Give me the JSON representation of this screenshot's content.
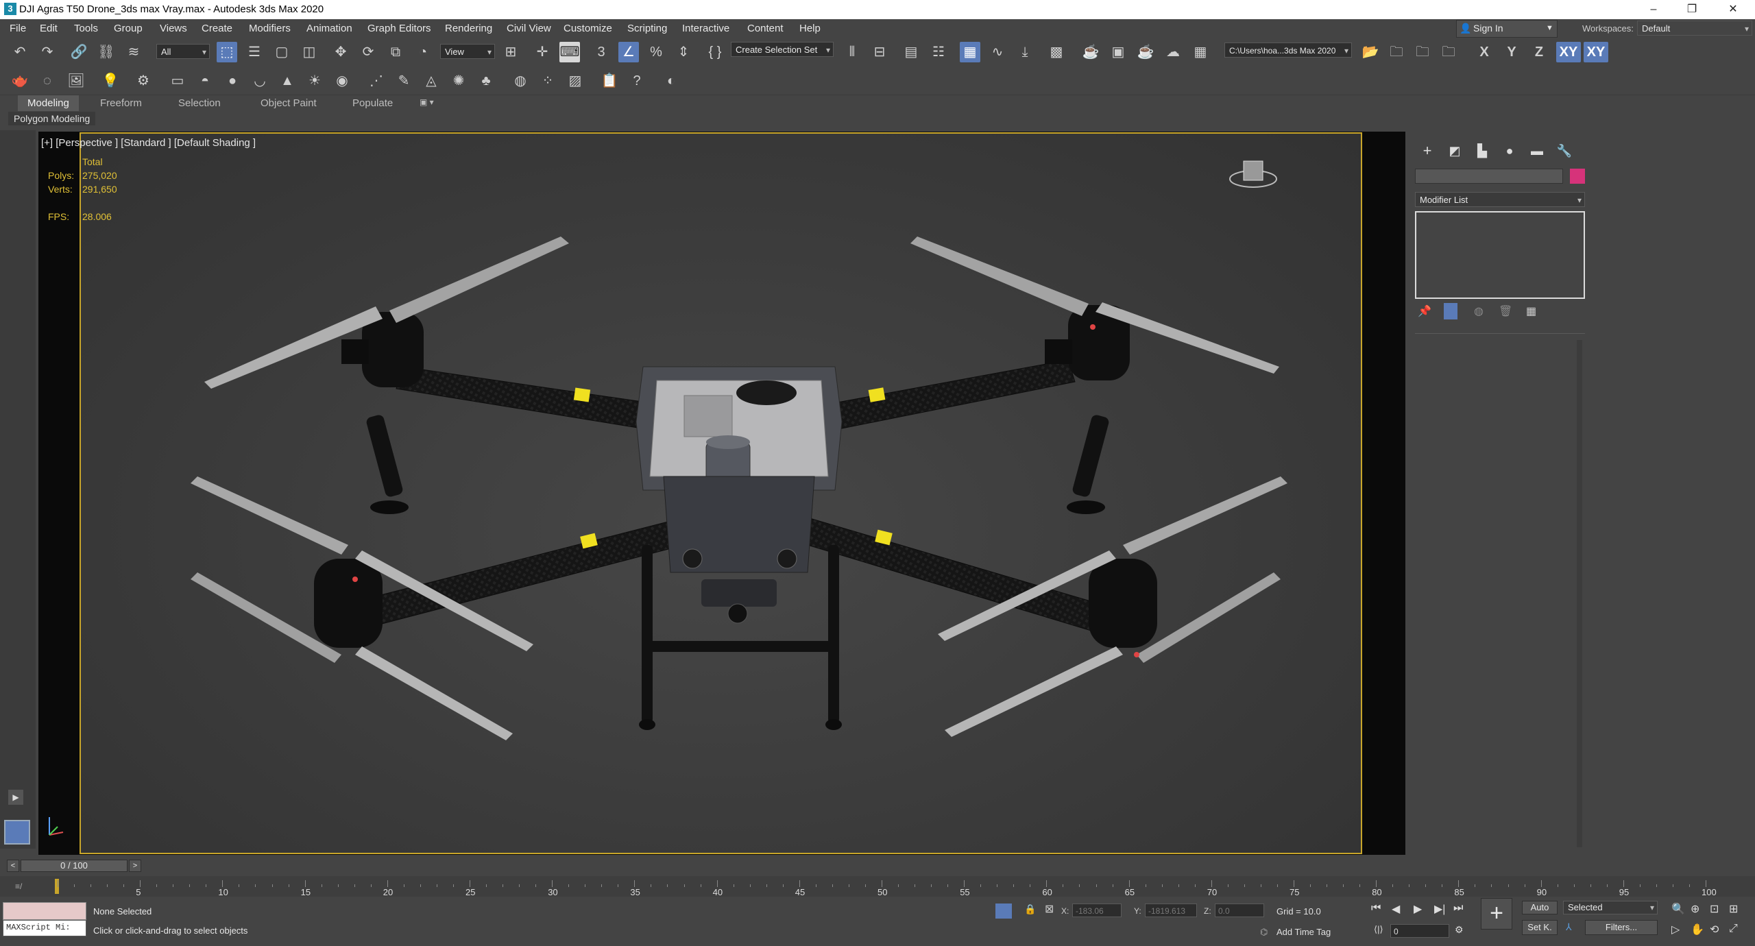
{
  "window": {
    "title": "DJI Agras T50 Drone_3ds max Vray.max - Autodesk 3ds Max 2020",
    "app_icon": "3",
    "minimize": "–",
    "restore": "❐",
    "close": "✕"
  },
  "menu": [
    "File",
    "Edit",
    "Tools",
    "Group",
    "Views",
    "Create",
    "Modifiers",
    "Animation",
    "Graph Editors",
    "Rendering",
    "Civil View",
    "Customize",
    "Scripting",
    "Interactive",
    "Content",
    "Help"
  ],
  "account": {
    "sign_in": "Sign In",
    "workspaces_label": "Workspaces:",
    "workspace": "Default"
  },
  "toolbar": {
    "selection_filter": "All",
    "reference_coord": "View",
    "selection_set": "Create Selection Set",
    "project_path": "C:\\Users\\hoa...3ds Max 2020",
    "axis_x": "X",
    "axis_y": "Y",
    "axis_z": "Z",
    "axis_xy": "XY",
    "axis_xyz": "XY"
  },
  "ribbon": {
    "tabs": [
      "Modeling",
      "Freeform",
      "Selection",
      "Object Paint",
      "Populate"
    ],
    "active_tab": "Modeling",
    "panel_label": "Polygon Modeling"
  },
  "viewport": {
    "label": "[+] [Perspective ] [Standard ] [Default Shading ]",
    "stats": {
      "total_label": "Total",
      "polys_label": "Polys:",
      "polys": "275,020",
      "verts_label": "Verts:",
      "verts": "291,650",
      "fps_label": "FPS:",
      "fps": "28.006"
    }
  },
  "command_panel": {
    "modifier_list": "Modifier List",
    "object_color": "#d6337a"
  },
  "timeline": {
    "frame": "0 / 100",
    "ticks": [
      "5",
      "10",
      "15",
      "20",
      "25",
      "30",
      "35",
      "40",
      "45",
      "50",
      "55",
      "60",
      "65",
      "70",
      "75",
      "80",
      "85",
      "90",
      "95",
      "100"
    ]
  },
  "status": {
    "maxscript": "MAXScript Mi:",
    "selection": "None Selected",
    "prompt": "Click or click-and-drag to select objects",
    "x_label": "X:",
    "x": "-183.06",
    "y_label": "Y:",
    "y": "-1819.613",
    "z_label": "Z:",
    "z": "0.0",
    "grid": "Grid = 10.0",
    "add_time_tag": "Add Time Tag",
    "auto_key": "Auto",
    "set_key": "Set K.",
    "key_filter": "Selected",
    "filters": "Filters...",
    "current_frame": "0"
  },
  "colors": {
    "accent": "#5a7bb8",
    "viewport_border": "#c8a52a",
    "stats_text": "#e0c036",
    "arm_band": "#f0e020"
  }
}
